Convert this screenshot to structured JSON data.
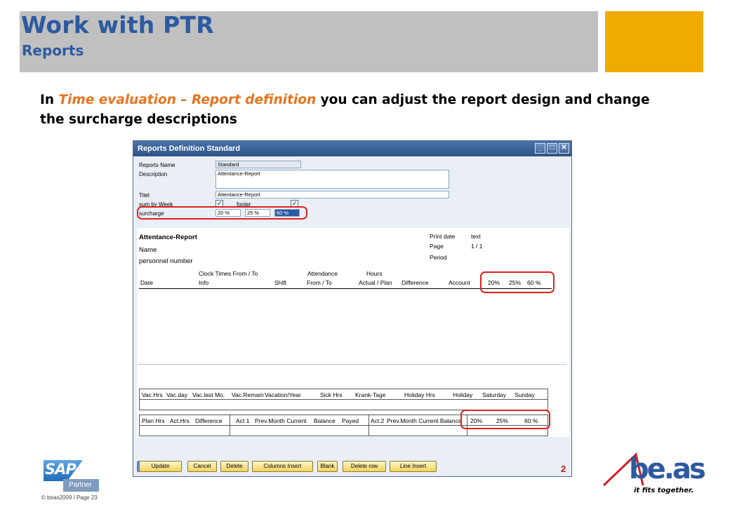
{
  "slide": {
    "title": "Work with PTR",
    "subtitle": "Reports",
    "intro_pre": "In ",
    "intro_highlight": "Time evaluation – Report definition",
    "intro_post": " you can adjust the report design and change the surcharge descriptions",
    "colors": {
      "title": "#2d5aa0",
      "accent": "#f0ab00",
      "highlight": "#e8731e",
      "callout": "#e02020"
    }
  },
  "window": {
    "title": "Reports Definition Standard",
    "controls": {
      "minimize": "_",
      "maximize": "□",
      "close": "✕"
    },
    "form": {
      "reports_name_label": "Reports Name",
      "reports_name_value": "Standard",
      "description_label": "Description",
      "description_value": "Attentance-Report",
      "titel_label": "Titel",
      "titel_value": "Attentance-Report",
      "sum_by_week_label": "sum by Week",
      "sum_by_week_checked": true,
      "footer_label": "footer",
      "footer_checked": true,
      "surcharge_label": "surcharge",
      "surcharge_values": [
        "20 %",
        "25 %",
        "60 %"
      ]
    },
    "report": {
      "heading": "Attentance-Report",
      "name_label": "Name",
      "personnel_label": "personnel number",
      "print_date_label": "Print date",
      "print_date_value": "text",
      "page_label": "Page",
      "page_value": "1 / 1",
      "period_label": "Period",
      "group_headers": {
        "clock_times": "Clock Times From / To",
        "attendance": "Attendance",
        "hours": "Hours"
      },
      "columns": {
        "date": "Date",
        "info": "Info",
        "shift": "Shift",
        "from_to": "From / To",
        "actual_plan": "Actual / Plan",
        "difference": "Difference",
        "account": "Account",
        "s20": "20%",
        "s25": "25%",
        "s60": "60 %"
      },
      "summary_table_1": {
        "headers": [
          "Vac.Hrs",
          "Vac.day",
          "Vac.last Mo.",
          "Vac.Remain",
          "Vacation/Year",
          "Sick Hrs",
          "Krank-Tage",
          "Holiday Hrs",
          "Holiday",
          "Saturday",
          "Sunday"
        ]
      },
      "summary_table_2": {
        "headers": [
          "Plan Hrs",
          "Act.Hrs",
          "Difference",
          "Act 1",
          "Prev.Month Current",
          "Balance",
          "Payed",
          "Act.2",
          "Prev.Month Current Balance",
          "20%",
          "25%",
          "60 %"
        ]
      }
    },
    "buttons": [
      "Update",
      "Cancel",
      "Delete",
      "Columns Insert",
      "Blank",
      "Delete row",
      "Line Insert"
    ],
    "mark": "2"
  },
  "footer": {
    "sap_logo": "SAP",
    "partner": "Partner",
    "copyright": "© beas2009 / Page 23",
    "beas_logo": "be.as",
    "beas_tagline": "it fits together."
  }
}
